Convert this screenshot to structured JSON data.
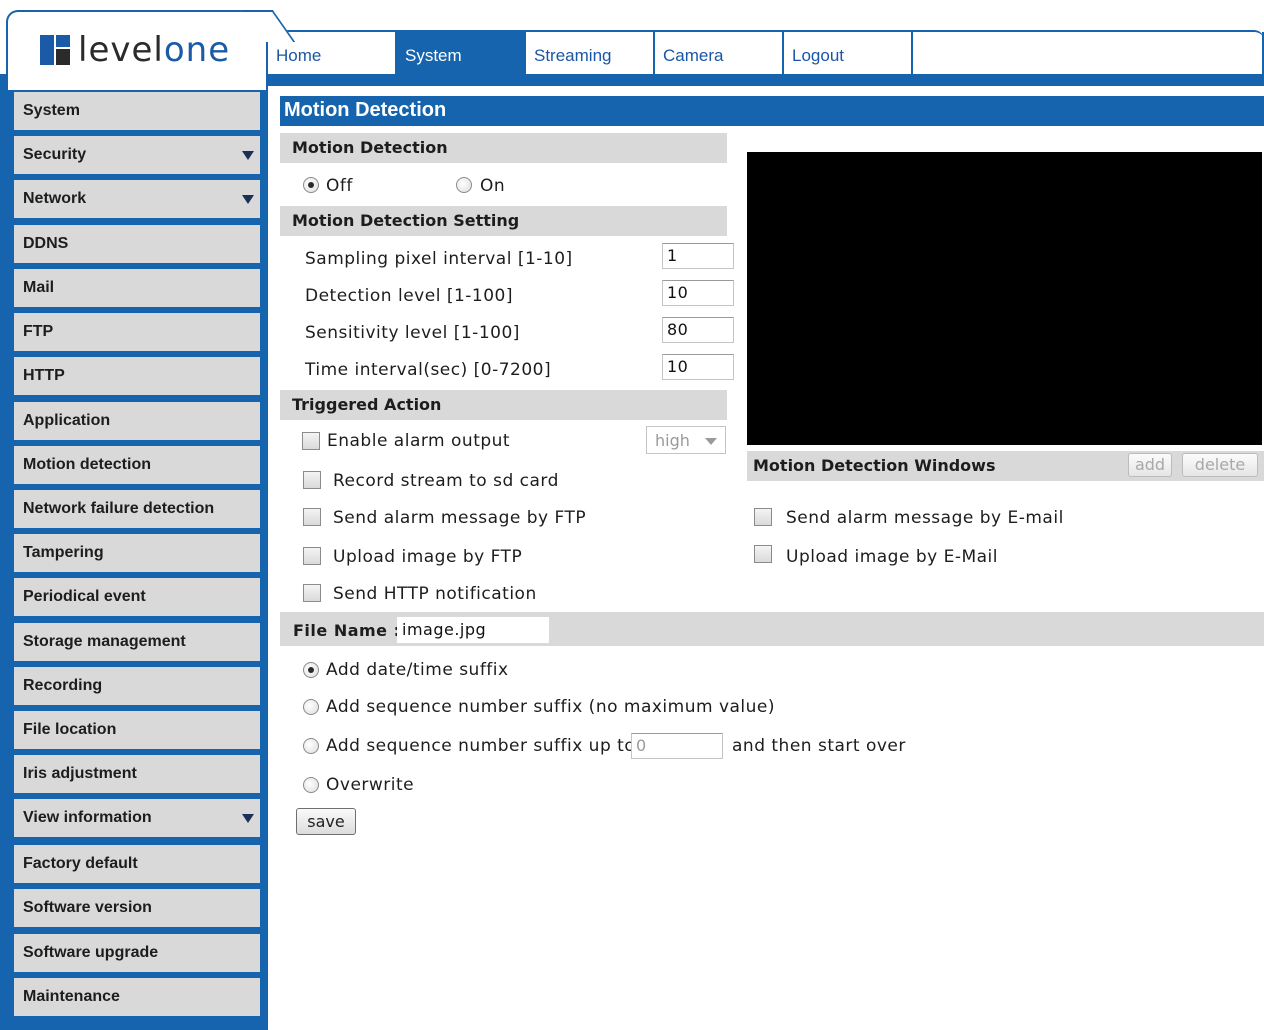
{
  "brand": {
    "logo_text_a": "level",
    "logo_text_b": "one"
  },
  "nav": {
    "tabs": [
      "Home",
      "System",
      "Streaming",
      "Camera",
      "Logout"
    ],
    "active": "System"
  },
  "sidebar": {
    "items": [
      "System",
      "Security",
      "Network",
      "DDNS",
      "Mail",
      "FTP",
      "HTTP",
      "Application",
      "Motion detection",
      "Network failure detection",
      "Tampering",
      "Periodical event",
      "Storage management",
      "Recording",
      "File location",
      "Iris adjustment",
      "View information",
      "Factory default",
      "Software version",
      "Software upgrade",
      "Maintenance"
    ]
  },
  "page": {
    "title": "Motion Detection"
  },
  "motion_detection": {
    "heading": "Motion Detection",
    "off_label": "Off",
    "on_label": "On",
    "selected": "Off"
  },
  "settings": {
    "heading": "Motion Detection Setting",
    "sampling_label": "Sampling pixel interval [1-10]",
    "sampling_value": "1",
    "detection_label": "Detection level [1-100]",
    "detection_value": "10",
    "sensitivity_label": "Sensitivity level [1-100]",
    "sensitivity_value": "80",
    "time_label": "Time interval(sec) [0-7200]",
    "time_value": "10"
  },
  "triggered": {
    "heading": "Triggered Action",
    "alarm_label": "Enable alarm output",
    "alarm_level": "high",
    "sd_label": "Record stream to sd card",
    "ftp_msg_label": "Send alarm message by FTP",
    "ftp_upload_label": "Upload image by FTP",
    "http_label": "Send HTTP notification",
    "email_msg_label": "Send alarm message by E-mail",
    "email_upload_label": "Upload image by E-Mail"
  },
  "windows": {
    "heading": "Motion Detection Windows",
    "add_label": "add",
    "delete_label": "delete"
  },
  "file": {
    "name_label": "File Name :",
    "name_value": "image.jpg",
    "opt_datetime": "Add date/time suffix",
    "opt_sequence": "Add sequence number suffix (no maximum value)",
    "opt_upto": "Add sequence number suffix up to",
    "upto_value": "0",
    "opt_upto_tail": "and then start over",
    "opt_overwrite": "Overwrite",
    "selected": "Add date/time suffix"
  },
  "actions": {
    "save_label": "save"
  },
  "colors": {
    "accent": "#1564ad",
    "panel_gray": "#d9d9d9"
  }
}
